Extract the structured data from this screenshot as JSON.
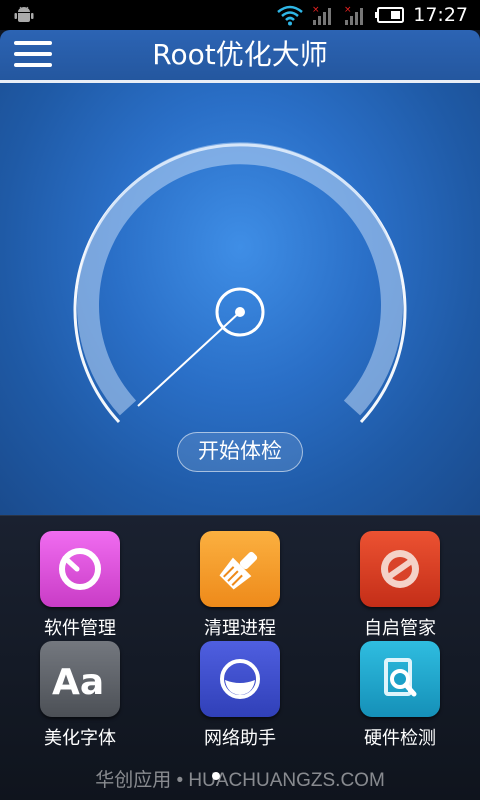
{
  "app": {
    "title": "Root优化大师",
    "start_button_label": "开始体检"
  },
  "status_bar": {
    "time": "17:27",
    "icons": [
      "android-icon",
      "wifi-icon",
      "signal-1-icon",
      "signal-2-icon",
      "battery-icon"
    ]
  },
  "tools": [
    {
      "label": "软件管理",
      "icon": "software-manage-icon",
      "color": "#d94ad6"
    },
    {
      "label": "清理进程",
      "icon": "broom-clean-icon",
      "color": "#f39a24"
    },
    {
      "label": "自启管家",
      "icon": "forbid-icon",
      "color": "#d93a22"
    },
    {
      "label": "美化字体",
      "icon": "font-aa-icon",
      "color": "#5d6168"
    },
    {
      "label": "网络助手",
      "icon": "network-icon",
      "color": "#3b48c9"
    },
    {
      "label": "硬件检测",
      "icon": "hardware-search-icon",
      "color": "#1aa0c8"
    }
  ],
  "watermark": "华创应用 • HUACHUANGZS.COM",
  "colors": {
    "header": "#2a62b0",
    "panel_blue": "#2a6fc7",
    "dark_bg": "#0f1622"
  }
}
